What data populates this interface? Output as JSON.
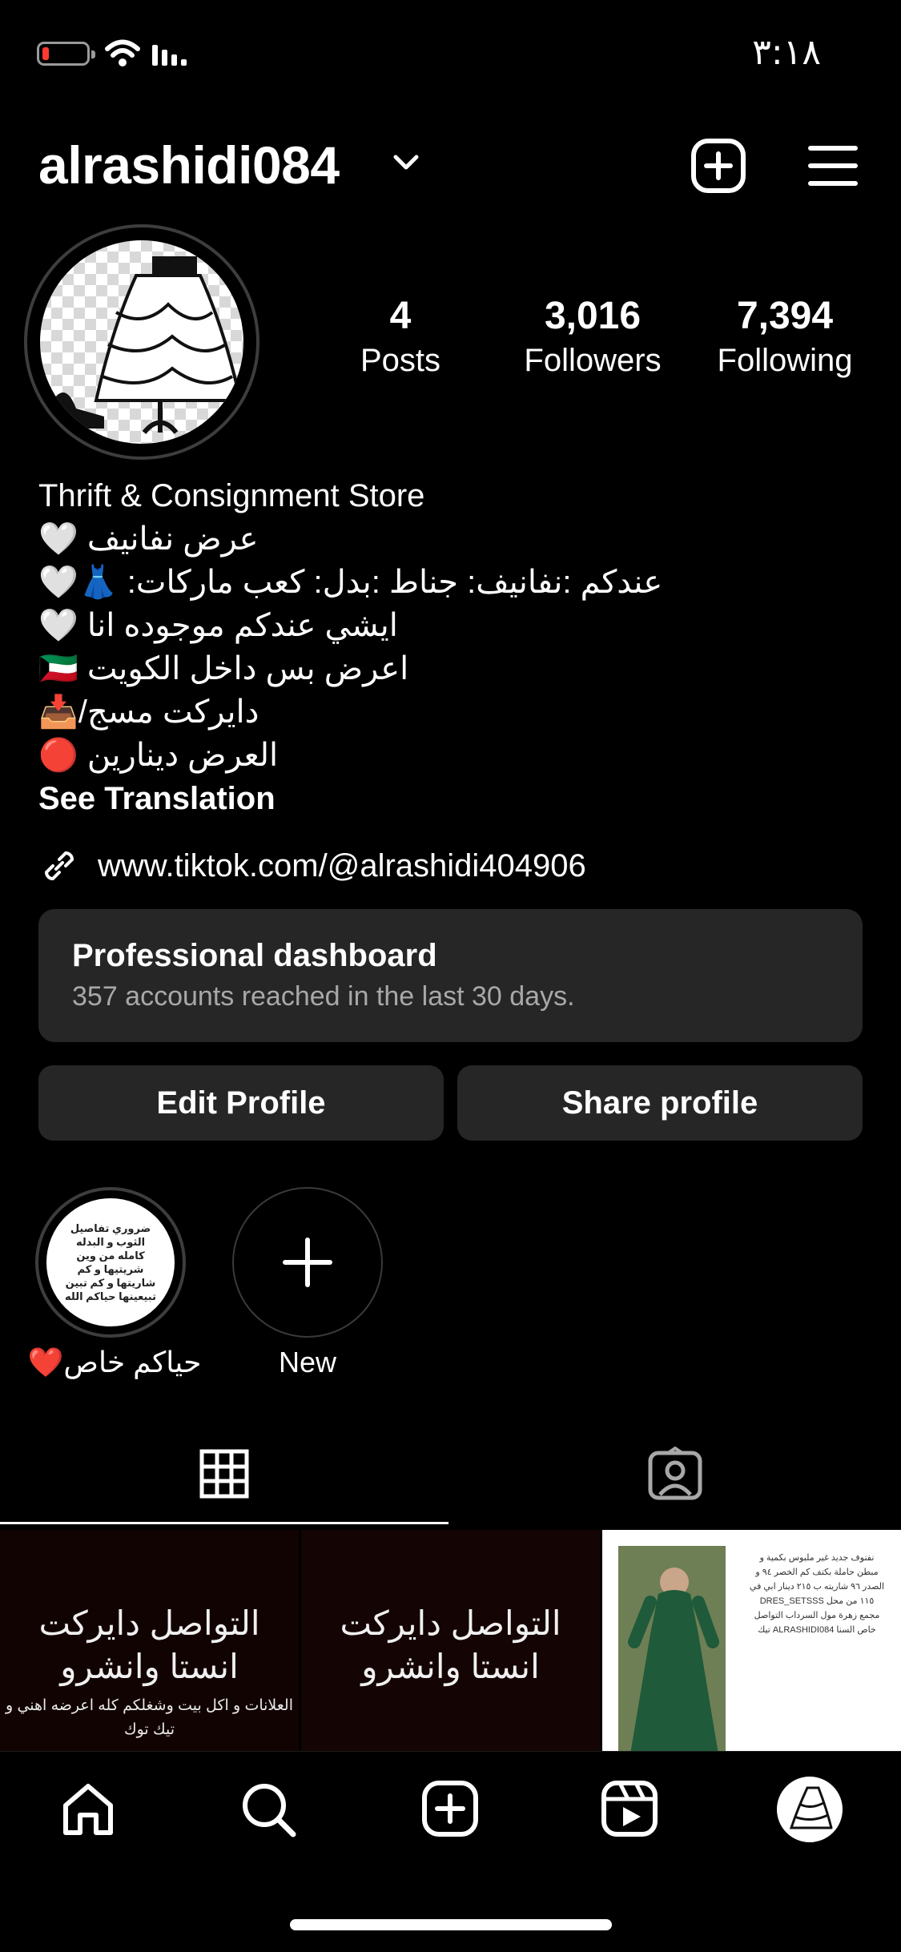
{
  "status_bar": {
    "time": "٣:١٨"
  },
  "header": {
    "username": "alrashidi084"
  },
  "stats": [
    {
      "value": "4",
      "label": "Posts"
    },
    {
      "value": "3,016",
      "label": "Followers"
    },
    {
      "value": "7,394",
      "label": "Following"
    }
  ],
  "bio": {
    "category": "Thrift & Consignment Store",
    "lines": [
      "عرض نفانيف 🤍",
      "عندكم :نفانيف: جناط :بدل: كعب ماركات: 👗🤍",
      "ايشي عندكم موجوده انا 🤍",
      "اعرض بس داخل الكويت 🇰🇼",
      "دايركت مسج/📥",
      "العرض دينارين 🔴"
    ],
    "see_translation": "See Translation",
    "link": "www.tiktok.com/@alrashidi404906"
  },
  "dashboard": {
    "title": "Professional dashboard",
    "subtitle": "357 accounts reached in the last 30 days."
  },
  "buttons": {
    "edit": "Edit Profile",
    "share": "Share profile"
  },
  "highlights": [
    {
      "label": "حياكم خاص❤️",
      "cover_text": "ضروري تفاصيل الثوب و البدله كامله من وين شريتيها و كم شاريتها و كم تبين تبيعينها حياكم الله"
    },
    {
      "label": "New"
    }
  ],
  "grid": [
    {
      "title": "التواصل دايركت انستا وانشرو",
      "caption": "العلانات و اكل بيت وشغلكم كله اعرضه اهني و تيك توك"
    },
    {
      "title": "التواصل دايركت انستا وانشرو"
    },
    {
      "caption": "نفنوف جديد غير ملبوس بكمية و مبطن حاملة بكتف كم الخصر ٩٤ و الصدر ٩٦ شاريته ب ٢١٥ دينار ابي في ١١٥ من محل DRES_SETSSS مجمع زهرة مول السرداب التواصل خاص السنا ALRASHIDI084 تيك"
    }
  ],
  "colors": {
    "background": "#000000",
    "card": "#262626",
    "muted_text": "#a8a8a8",
    "battery_low": "#ff3b30"
  },
  "icons": [
    "battery-icon",
    "wifi-icon",
    "signal-icon",
    "chevron-down-icon",
    "create-icon",
    "menu-icon",
    "link-icon",
    "plus-icon",
    "grid-icon",
    "tagged-icon",
    "home-icon",
    "search-icon",
    "reels-icon",
    "profile-avatar-icon"
  ]
}
